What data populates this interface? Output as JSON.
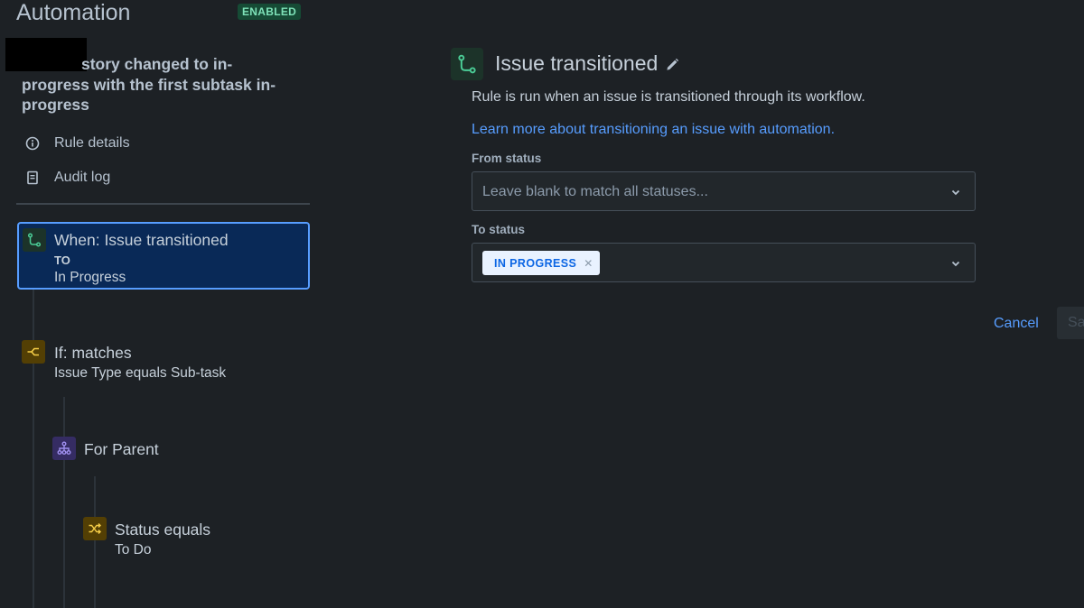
{
  "app": {
    "title": "Automation",
    "status": "ENABLED"
  },
  "rule": {
    "name": "story changed to in-progress with the first subtask in-progress"
  },
  "nav": {
    "rule_details": "Rule details",
    "audit_log": "Audit log"
  },
  "flow": {
    "trigger": {
      "title": "When: Issue transitioned",
      "caps": "TO",
      "sub": "In Progress",
      "icon": "transition-icon"
    },
    "condition": {
      "title": "If: matches",
      "sub": "Issue Type equals Sub-task",
      "icon": "branch-condition-icon"
    },
    "branch": {
      "title": "For Parent",
      "icon": "hierarchy-icon"
    },
    "nested_condition": {
      "title": "Status equals",
      "sub": "To Do",
      "icon": "shuffle-icon"
    }
  },
  "detail": {
    "title": "Issue transitioned",
    "description": "Rule is run when an issue is transitioned through its workflow.",
    "learn_more": "Learn more about transitioning an issue with automation.",
    "from_status": {
      "label": "From status",
      "placeholder": "Leave blank to match all statuses..."
    },
    "to_status": {
      "label": "To status",
      "selected": "IN PROGRESS"
    }
  },
  "actions": {
    "cancel": "Cancel",
    "save": "Sa"
  },
  "colors": {
    "background": "#1d2125",
    "accent_blue": "#579dff",
    "selected_card": "#092957",
    "enabled_green": "#7ee2b8",
    "trigger_green": "#4bce97",
    "condition_yellow": "#f5cd47",
    "branch_purple": "#9f8fef"
  }
}
